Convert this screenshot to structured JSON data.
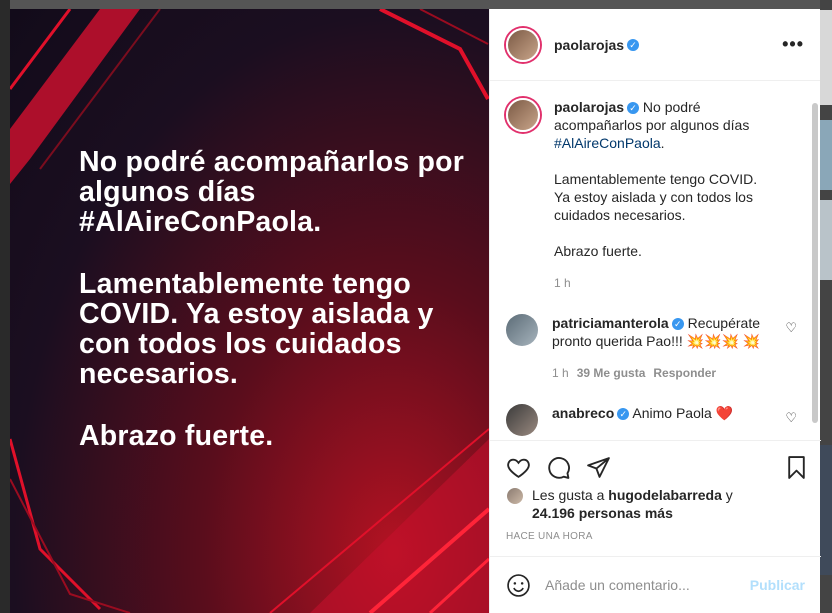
{
  "post": {
    "image_text": {
      "line1": "No podré acompañarlos por algunos días #AlAireConPaola.",
      "line2": "Lamentablemente tengo COVID. Ya estoy aislada y con todos los cuidados necesarios.",
      "line3": "Abrazo fuerte."
    }
  },
  "header": {
    "username": "paolarojas",
    "more_icon": "more-horizontal-icon"
  },
  "caption": {
    "username": "paolarojas",
    "text_before": "No podré acompañarlos por algunos días ",
    "hashtag": "#AlAireConPaola",
    "text_after": ".\n\nLamentablemente tengo COVID. Ya estoy aislada y con todos los cuidados necesarios.\n\nAbrazo fuerte.",
    "time": "1 h"
  },
  "comments": [
    {
      "username": "patriciamanterola",
      "text": "Recupérate pronto querida Pao!!! 💥💥💥 💥",
      "time": "1 h",
      "likes": "39 Me gusta",
      "reply": "Responder"
    },
    {
      "username": "anabreco",
      "text": "Animo Paola ❤️"
    }
  ],
  "likes": {
    "prefix": "Les gusta a ",
    "user": "hugodelabarreda",
    "suffix": " y",
    "count": "24.196 personas más"
  },
  "timestamp": "HACE UNA HORA",
  "add_comment": {
    "placeholder": "Añade un comentario...",
    "publish": "Publicar"
  },
  "colors": {
    "accent": "#3897f0",
    "publish_disabled": "#b2dffc",
    "image_red": "#e0102a"
  }
}
